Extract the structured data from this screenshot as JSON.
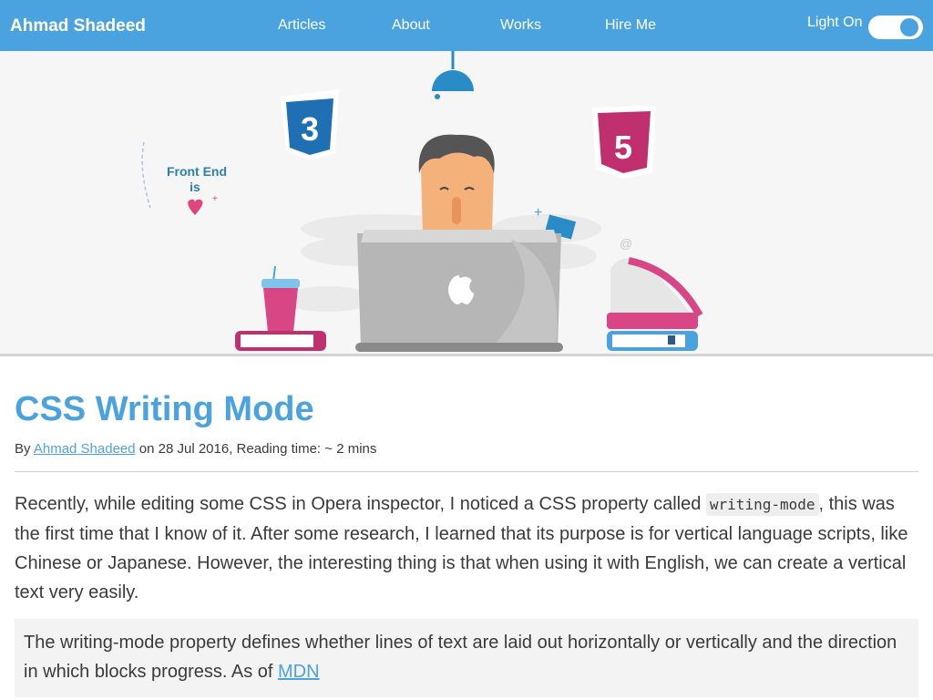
{
  "header": {
    "brand": "Ahmad Shadeed",
    "nav": [
      "Articles",
      "About",
      "Works",
      "Hire Me"
    ],
    "toggle_label": "Light On"
  },
  "hero": {
    "sign_text_1": "Front End",
    "sign_text_2": "is",
    "css_badge": "3",
    "html_badge": "5"
  },
  "article": {
    "title": "CSS Writing Mode",
    "meta_by": "By",
    "author": "Ahmad Shadeed",
    "meta_rest": "on 28 Jul 2016, Reading time: ~ 2 mins",
    "para_before": "Recently, while editing some CSS in Opera inspector, I noticed a CSS property called ",
    "para_code": "writing-mode",
    "para_after": ", this was the first time that I know of it. After some research, I learned that its purpose is for vertical language scripts, like Chinese or Japanese. However, the interesting thing is that when using it with English, we can create a vertical text very easily.",
    "quote_text": "The writing-mode property defines whether lines of text are laid out horizontally or vertically and the direction in which blocks progress. As of ",
    "quote_link": "MDN"
  },
  "colors": {
    "accent": "#4aa3df",
    "hero_bg": "#f6f6f6"
  }
}
